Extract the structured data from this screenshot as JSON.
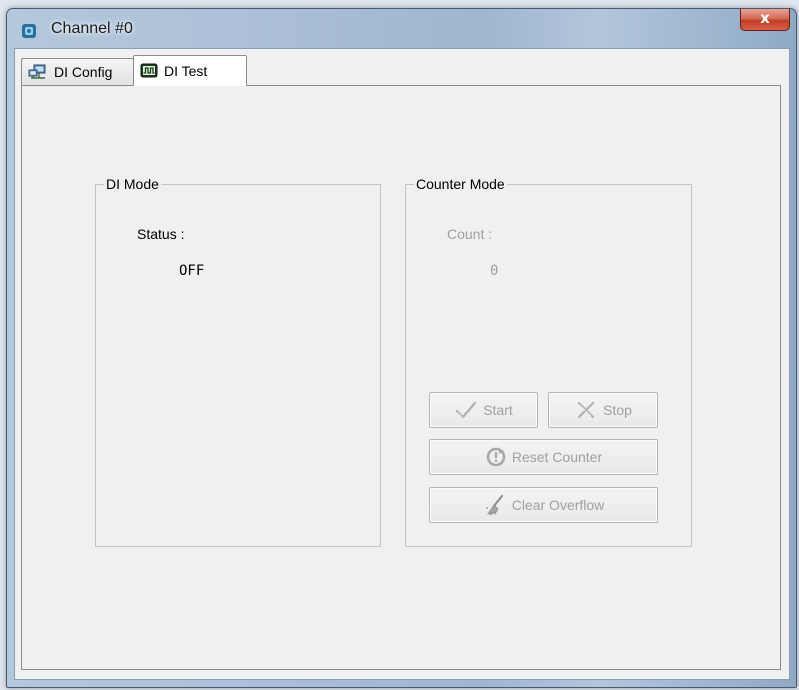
{
  "window": {
    "title": "Channel #0",
    "close_label": "x"
  },
  "tabs": [
    {
      "label": "DI Config",
      "icon": "computer-network-icon",
      "active": false
    },
    {
      "label": "DI Test",
      "icon": "waveform-monitor-icon",
      "active": true
    }
  ],
  "di_mode": {
    "title": "DI Mode",
    "status_label": "Status :",
    "status_value": "OFF"
  },
  "counter_mode": {
    "title": "Counter Mode",
    "count_label": "Count :",
    "count_value": "0",
    "buttons": {
      "start": "Start",
      "stop": "Stop",
      "reset": "Reset Counter",
      "clear": "Clear Overflow"
    }
  },
  "colors": {
    "disabled_text": "#a0a0a0",
    "close_button": "#c23d24"
  }
}
